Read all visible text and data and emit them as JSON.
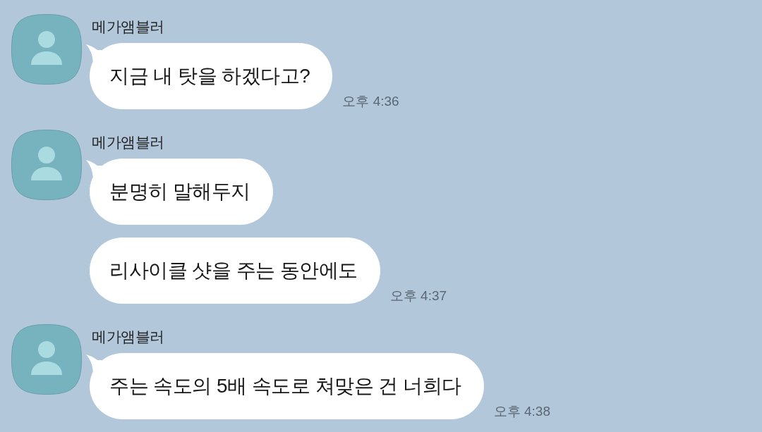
{
  "chat": {
    "groups": [
      {
        "sender": "메가앰블러",
        "messages": [
          {
            "text": "지금 내 탓을 하겠다고?",
            "time": "오후 4:36"
          }
        ]
      },
      {
        "sender": "메가앰블러",
        "messages": [
          {
            "text": "분명히 말해두지"
          },
          {
            "text": "리사이클 샷을 주는 동안에도",
            "time": "오후 4:37"
          }
        ]
      },
      {
        "sender": "메가앰블러",
        "messages": [
          {
            "text": "주는 속도의 5배 속도로 쳐맞은 건 너희다",
            "time": "오후 4:38"
          }
        ]
      }
    ]
  }
}
